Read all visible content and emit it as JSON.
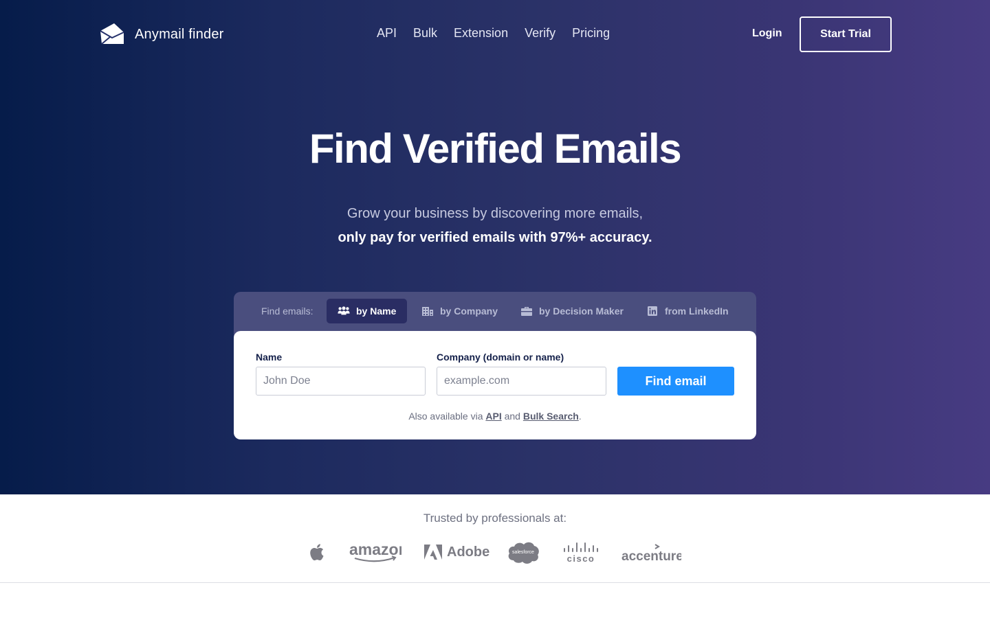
{
  "brand": {
    "name": "Anymail finder",
    "icon": "envelope-logo-icon"
  },
  "nav": {
    "items": [
      "API",
      "Bulk",
      "Extension",
      "Verify",
      "Pricing"
    ],
    "login": "Login",
    "start_trial": "Start Trial"
  },
  "hero": {
    "title": "Find Verified Emails",
    "subtitle_line1": "Grow your business by discovering more emails,",
    "subtitle_line2": "only pay for verified emails with 97%+ accuracy."
  },
  "search": {
    "tabs_label": "Find emails:",
    "tabs": [
      {
        "label": "by Name",
        "icon": "people-icon",
        "active": true
      },
      {
        "label": "by Company",
        "icon": "building-icon",
        "active": false
      },
      {
        "label": "by Decision Maker",
        "icon": "briefcase-icon",
        "active": false
      },
      {
        "label": "from LinkedIn",
        "icon": "linkedin-icon",
        "active": false
      }
    ],
    "name_label": "Name",
    "name_placeholder": "John Doe",
    "company_label": "Company (domain or name)",
    "company_placeholder": "example.com",
    "submit": "Find email",
    "also_prefix": "Also available via",
    "also_api": "API",
    "also_and": "and",
    "also_bulk": "Bulk Search",
    "also_suffix": "."
  },
  "trusted": {
    "label": "Trusted by professionals at:",
    "logos": [
      "apple",
      "amazon",
      "Adobe",
      "salesforce",
      "cisco",
      "accenture"
    ]
  },
  "colors": {
    "accent": "#1e90ff",
    "hero_start": "#061c4a",
    "hero_end": "#473b82",
    "tab_active": "#2a2d63"
  }
}
